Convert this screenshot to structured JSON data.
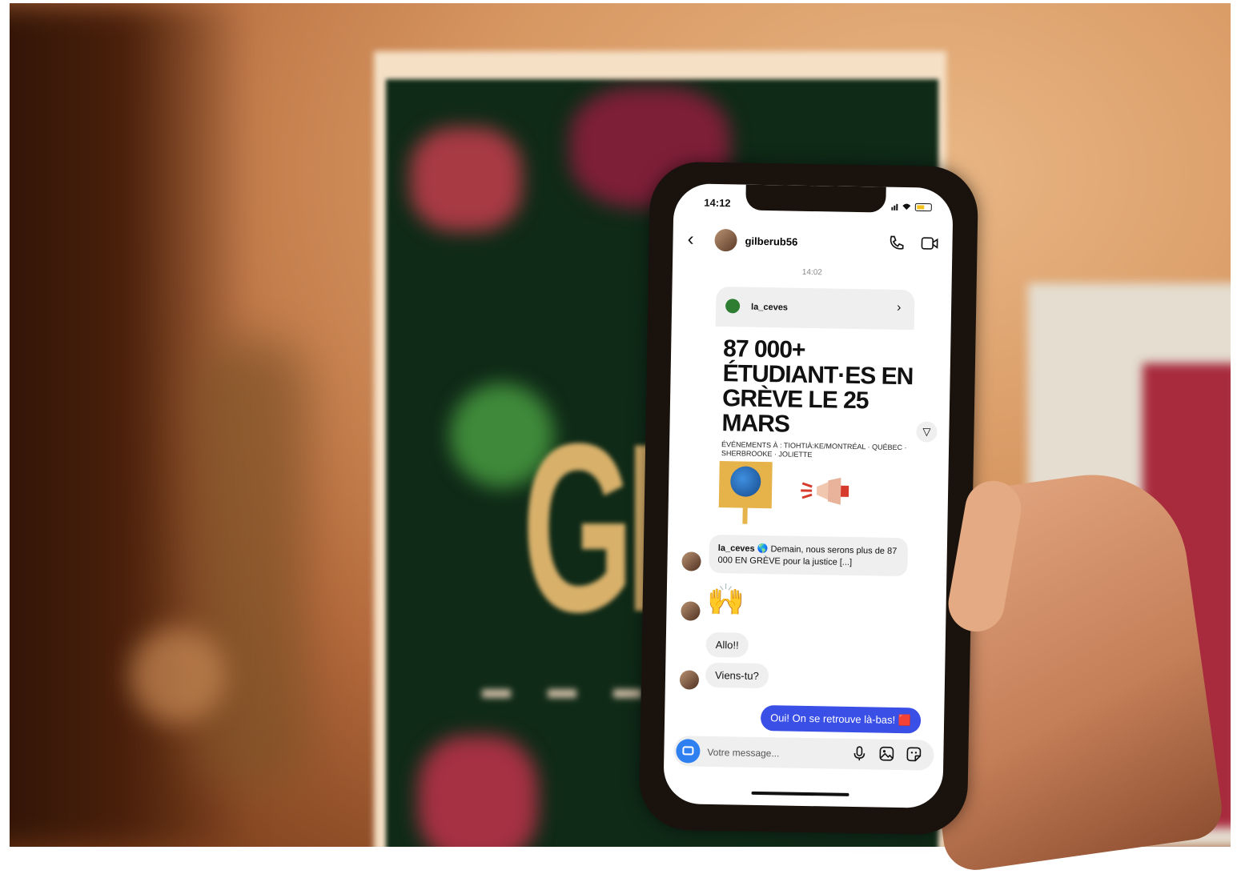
{
  "status_bar": {
    "time": "14:12"
  },
  "chat": {
    "username": "gilberub56",
    "timestamp": "14:02",
    "shared_post": {
      "account": "la_ceves",
      "headline": "87 000+ ÉTUDIANT·ES EN GRÈVE LE 25 MARS",
      "subline": "ÉVÉNEMENTS À : TIOHTIÀ:KE/MONTRÉAL · QUÉBEC · SHERBROOKE · JOLIETTE"
    },
    "caption": {
      "author": "la_ceves",
      "text": "🌎 Demain, nous serons plus de 87 000 EN GRÈVE pour la justice [...]"
    },
    "reaction_emoji": "🙌",
    "messages": [
      {
        "from": "them",
        "text": "Allo!!"
      },
      {
        "from": "them",
        "text": "Viens-tu?"
      },
      {
        "from": "me",
        "text": "Oui! On se retrouve là-bas! 🟥"
      }
    ],
    "composer_placeholder": "Votre message..."
  },
  "colors": {
    "accent_blue": "#3a4fe6",
    "camera_blue": "#2e80f0",
    "bubble_gray": "#efefef"
  },
  "icons": [
    "back-icon",
    "call-icon",
    "video-icon",
    "chevron-right-icon",
    "send-icon",
    "camera-icon",
    "mic-icon",
    "gallery-icon",
    "sticker-icon"
  ]
}
